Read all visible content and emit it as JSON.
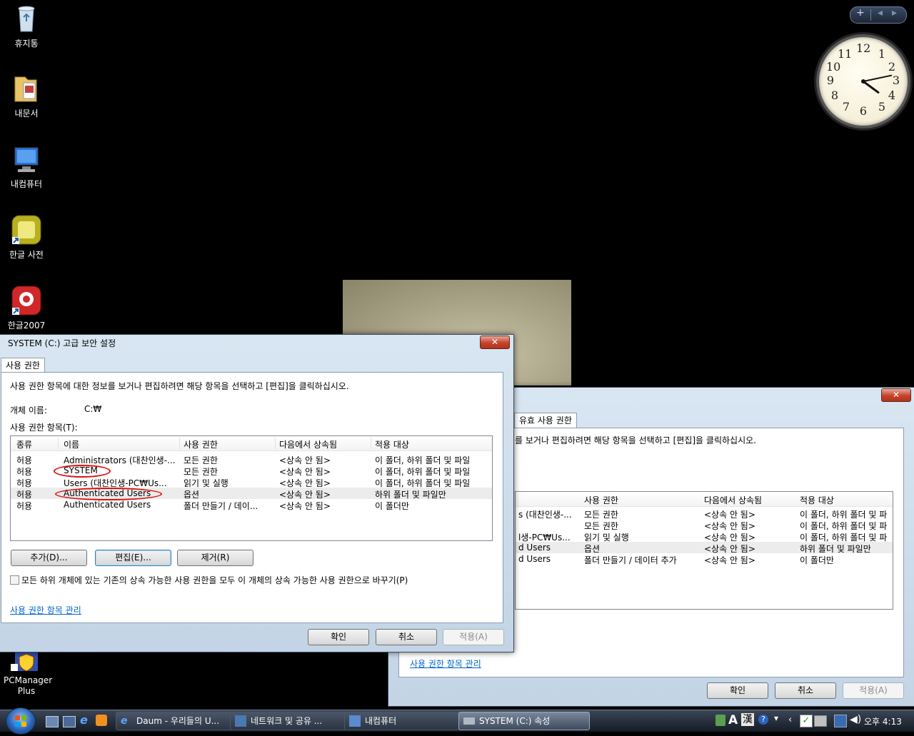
{
  "desktop": {
    "icons": [
      {
        "label": "휴지통"
      },
      {
        "label": "내문서"
      },
      {
        "label": "내컴퓨터"
      },
      {
        "label": "한글 사전"
      },
      {
        "label": "한글2007"
      },
      {
        "label": "PCManager Plus"
      }
    ],
    "gadget_bar": {
      "add": "+",
      "prev": "◂",
      "next": "▸"
    },
    "clock": {
      "hour": 4,
      "minute": 13
    }
  },
  "front_window": {
    "title": "SYSTEM (C:) 고급 보안 설정",
    "close_label": "✕",
    "tab_label": "사용 권한",
    "instruction": "사용 권한 항목에 대한 정보를 보거나 편집하려면 해당 항목을 선택하고 [편집]을 클릭하십시오.",
    "object_name_label": "개체 이름:",
    "object_name_value": "C:₩",
    "entries_label": "사용 권한 항목(T):",
    "columns": [
      "종류",
      "이름",
      "사용 권한",
      "다음에서 상속됨",
      "적용 대상"
    ],
    "rows": [
      {
        "type": "허용",
        "name": "Administrators (대찬인생-...",
        "perm": "모든 권한",
        "inherited": "<상속 안 됨>",
        "applies": "이 폴더, 하위 폴더 및 파일"
      },
      {
        "type": "허용",
        "name": "SYSTEM",
        "perm": "모든 권한",
        "inherited": "<상속 안 됨>",
        "applies": "이 폴더, 하위 폴더 및 파일"
      },
      {
        "type": "허용",
        "name": "Users (대찬인생-PC₩Us...",
        "perm": "읽기 및 실행",
        "inherited": "<상속 안 됨>",
        "applies": "이 폴더, 하위 폴더 및 파일"
      },
      {
        "type": "허용",
        "name": "Authenticated Users",
        "perm": "옵션",
        "inherited": "<상속 안 됨>",
        "applies": "하위 폴더 및 파일만"
      },
      {
        "type": "허용",
        "name": "Authenticated Users",
        "perm": "폴더 만들기 / 데이...",
        "inherited": "<상속 안 됨>",
        "applies": "이 폴더만"
      }
    ],
    "add_button": "추가(D)...",
    "edit_button": "편집(E)...",
    "remove_button": "제거(R)",
    "replace_checkbox": "모든 하위 개체에 있는 기존의 상속 가능한 사용 권한을 모두 이 개체의 상속 가능한 사용 권한으로 바꾸기(P)",
    "manage_link": "사용 권한 항목 관리",
    "ok_button": "확인",
    "cancel_button": "취소",
    "apply_button": "적용(A)"
  },
  "back_window": {
    "close_label": "✕",
    "tab_label": "유효 사용 권한",
    "instruction": "를 보거나 편집하려면 해당 항목을 선택하고 [편집]을 클릭하십시오.",
    "columns": [
      "사용 권한",
      "다음에서 상속됨",
      "적용 대상"
    ],
    "rows": [
      {
        "name": "s (대찬인생-...",
        "perm": "모든 권한",
        "inherited": "<상속 안 됨>",
        "applies": "이 폴더, 하위 폴더 및 파"
      },
      {
        "name": "",
        "perm": "모든 권한",
        "inherited": "<상속 안 됨>",
        "applies": "이 폴더, 하위 폴더 및 파"
      },
      {
        "name": "l생-PC₩Us...",
        "perm": "읽기 및 실행",
        "inherited": "<상속 안 됨>",
        "applies": "이 폴더, 하위 폴더 및 파"
      },
      {
        "name": "d Users",
        "perm": "옵션",
        "inherited": "<상속 안 됨>",
        "applies": "하위 폴더 및 파일만"
      },
      {
        "name": "d Users",
        "perm": "폴더 만들기 / 데이터 추가",
        "inherited": "<상속 안 됨>",
        "applies": "이 폴더만"
      }
    ],
    "manage_link": "사용 권한 항목 관리",
    "ok_button": "확인",
    "cancel_button": "취소",
    "apply_button": "적용(A)"
  },
  "taskbar": {
    "buttons": [
      {
        "label": "Daum - 우리들의 U..."
      },
      {
        "label": "네트워크 및 공유 ..."
      },
      {
        "label": "내컴퓨터"
      },
      {
        "label": "SYSTEM (C:) 속성"
      }
    ],
    "tray": {
      "ime_a": "A",
      "ime_han": "漢",
      "time": "오후 4:13"
    }
  },
  "colors": {
    "link": "#0066cc",
    "annotation": "#e01010",
    "desktop": "#000000"
  }
}
